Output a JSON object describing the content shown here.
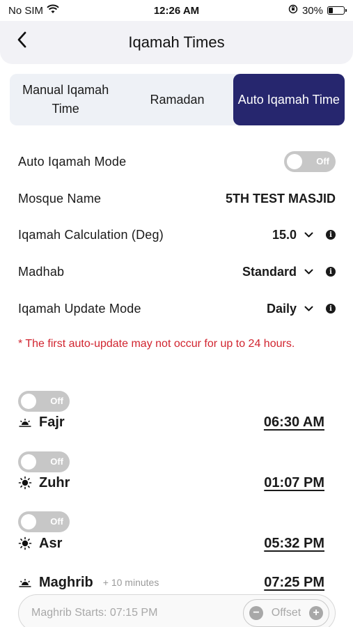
{
  "status_bar": {
    "carrier": "No SIM",
    "time": "12:26 AM",
    "battery": "30%",
    "battery_level": 0.3,
    "icons": [
      "wifi-icon",
      "orientation-lock-icon",
      "battery-icon"
    ]
  },
  "header": {
    "title": "Iqamah Times",
    "back_icon": "chevron-left-icon"
  },
  "tabs": [
    {
      "label": "Manual Iqamah Time",
      "active": false
    },
    {
      "label": "Ramadan",
      "active": false
    },
    {
      "label": "Auto Iqamah Time",
      "active": true
    }
  ],
  "settings": {
    "auto_mode": {
      "label": "Auto Iqamah Mode",
      "toggle": "Off"
    },
    "mosque": {
      "label": "Mosque Name",
      "value": "5TH TEST MASJID"
    },
    "calculation": {
      "label": "Iqamah Calculation (Deg)",
      "value": "15.0"
    },
    "madhab": {
      "label": "Madhab",
      "value": "Standard"
    },
    "update_mode": {
      "label": "Iqamah Update Mode",
      "value": "Daily"
    }
  },
  "note": "* The first auto-update may not occur for up to 24 hours.",
  "prayers": [
    {
      "name": "Fajr",
      "time": "06:30 AM",
      "toggle": "Off",
      "icon": "sunrise-icon"
    },
    {
      "name": "Zuhr",
      "time": "01:07 PM",
      "toggle": "Off",
      "icon": "sun-icon"
    },
    {
      "name": "Asr",
      "time": "05:32 PM",
      "toggle": "Off",
      "icon": "sun-icon"
    },
    {
      "name": "Maghrib",
      "extra": "+ 10 minutes",
      "time": "07:25 PM",
      "icon": "sunset-icon"
    }
  ],
  "maghrib_bar": {
    "text": "Maghrib Starts: 07:15 PM",
    "offset_label": "Offset",
    "minus": "−",
    "plus": "+"
  },
  "colors": {
    "accent": "#26266e",
    "warning": "#d1242f",
    "toggle_off": "#c7c7c7"
  }
}
